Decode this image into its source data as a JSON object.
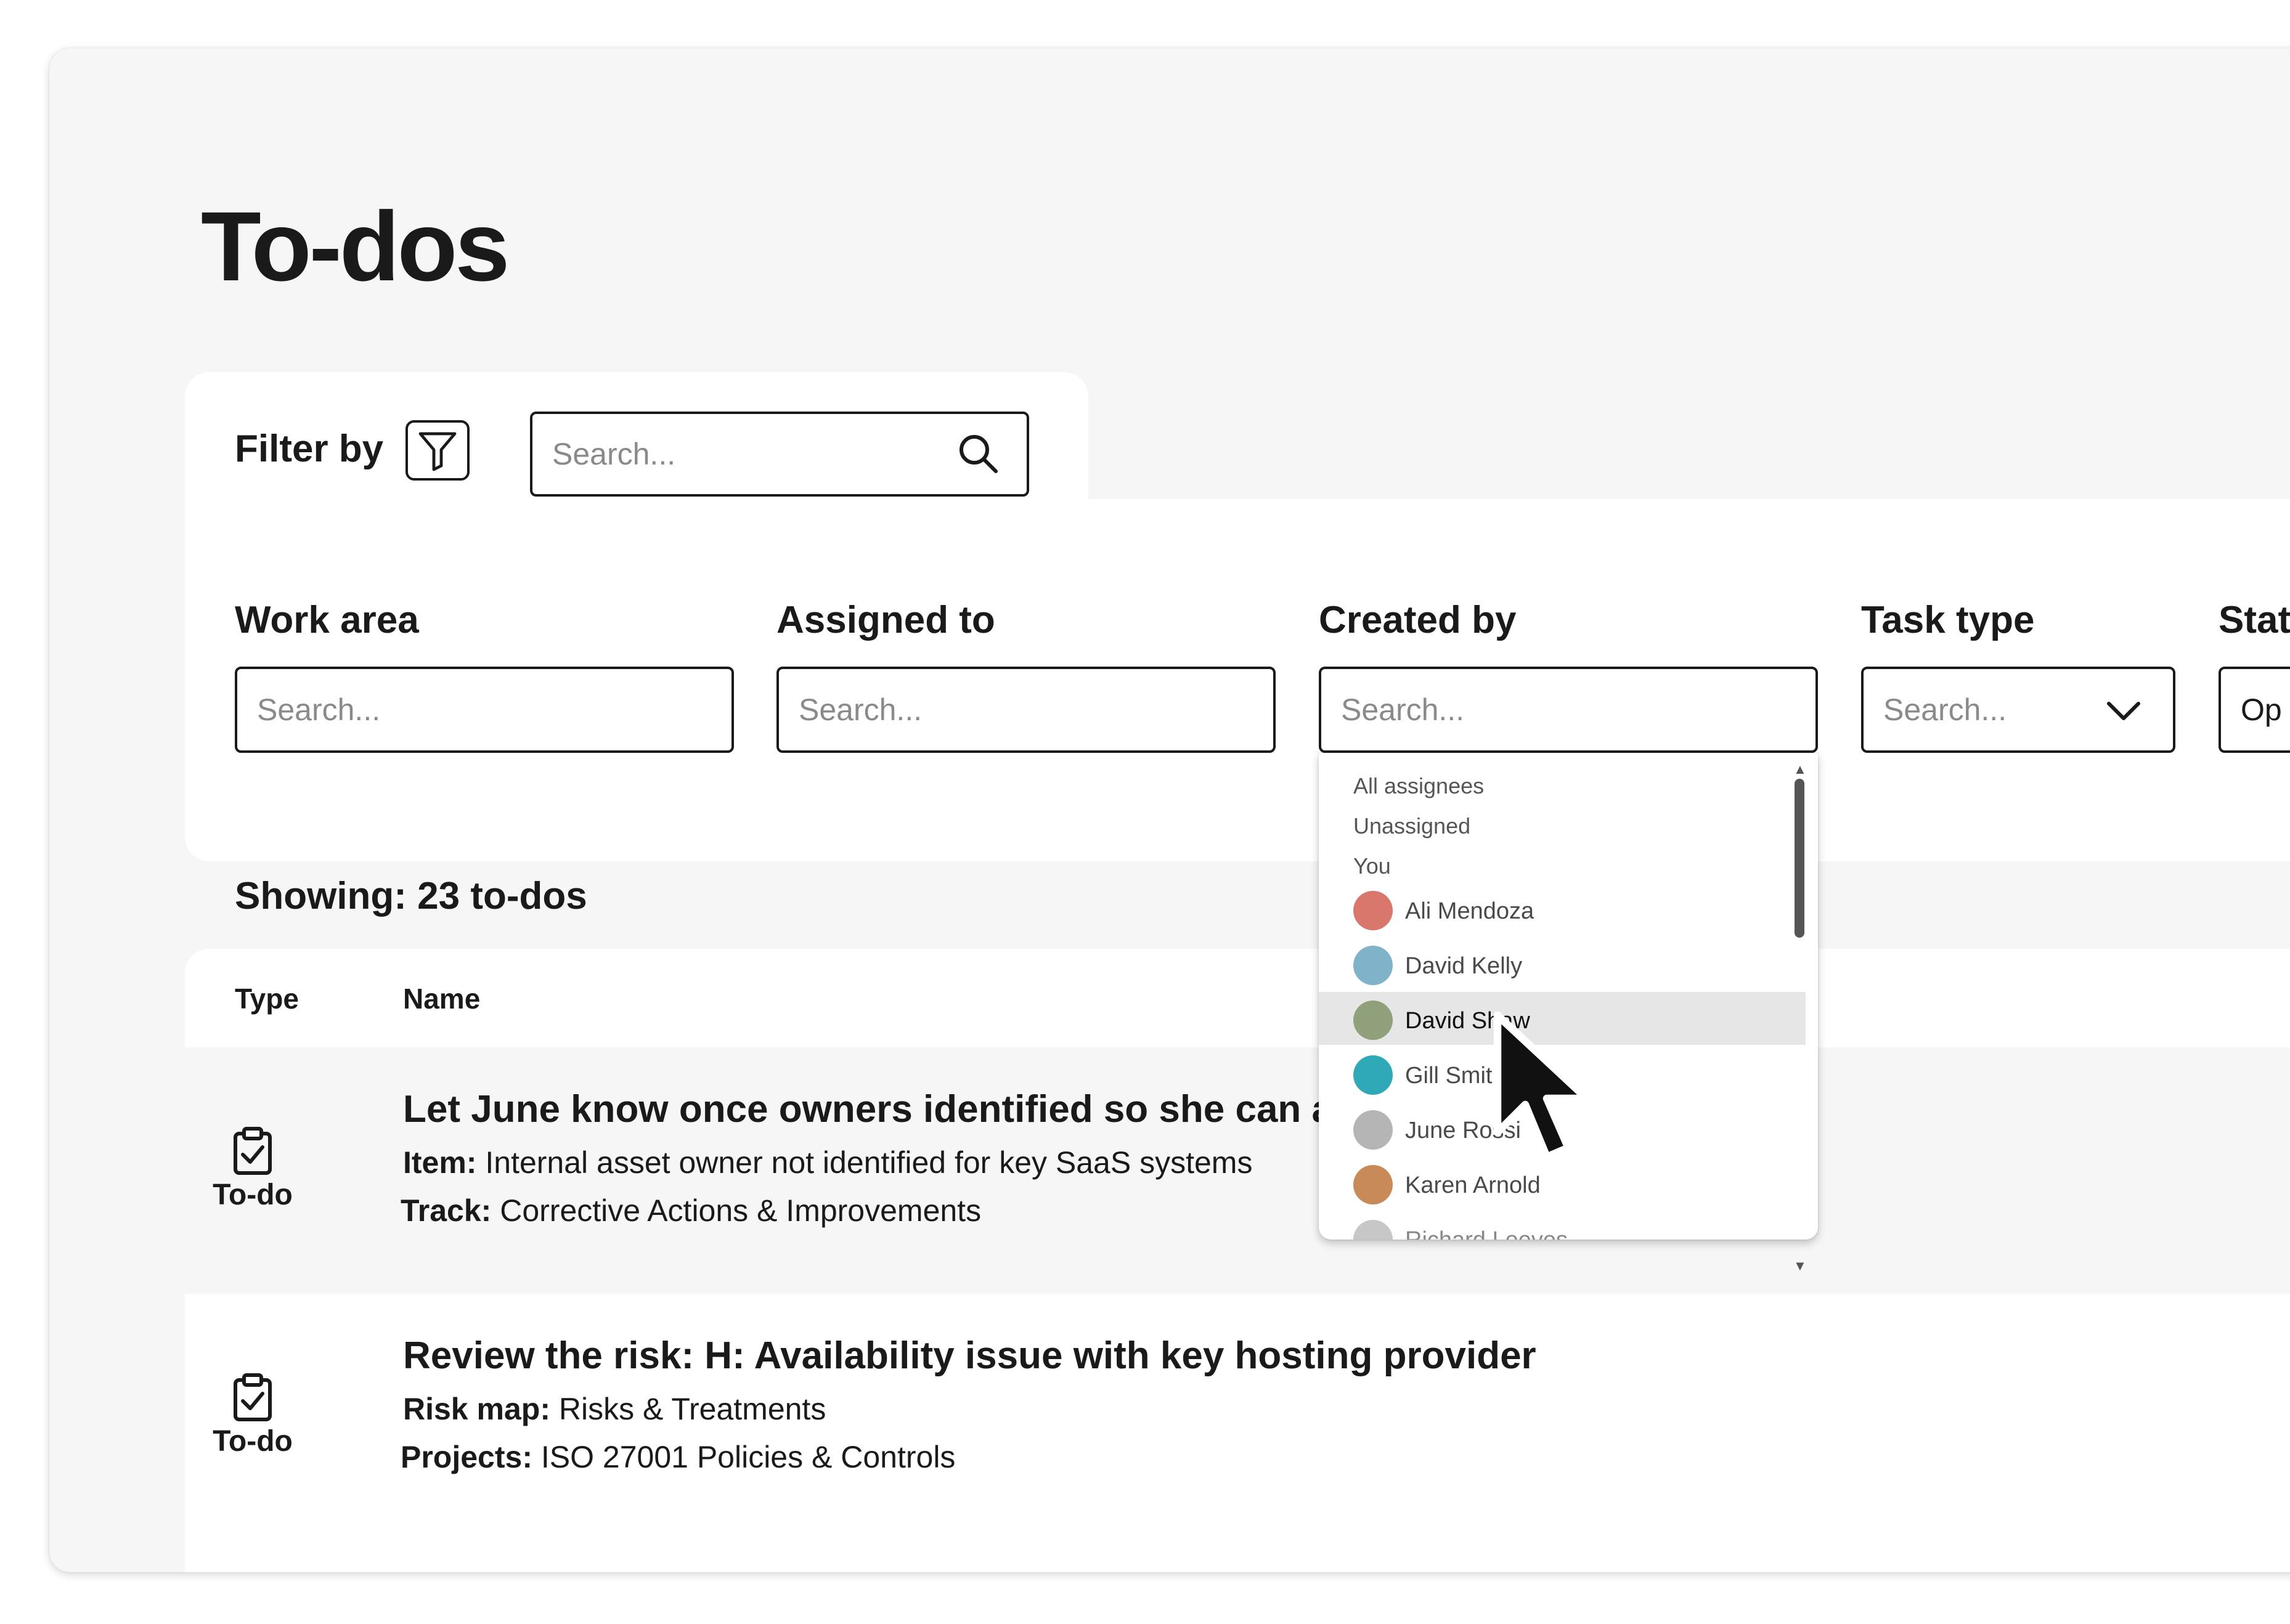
{
  "page": {
    "title": "To-dos"
  },
  "filters": {
    "filter_by_label": "Filter by",
    "search_placeholder": "Search...",
    "columns": [
      {
        "label": "Work area",
        "placeholder": "Search..."
      },
      {
        "label": "Assigned to",
        "placeholder": "Search..."
      },
      {
        "label": "Created by",
        "placeholder": "Search..."
      },
      {
        "label": "Task type",
        "placeholder": "Search..."
      },
      {
        "label": "Stat",
        "value": "Op"
      }
    ]
  },
  "summary": {
    "showing": "Showing: 23 to-dos"
  },
  "table": {
    "headers": [
      "Type",
      "Name"
    ],
    "rows": [
      {
        "type": "To-do",
        "title": "Let June know once owners identified so she can ar",
        "meta": [
          {
            "label": "Item:",
            "value": "Internal asset owner not identified for key SaaS systems"
          },
          {
            "label": "Track:",
            "value": "Corrective Actions & Improvements"
          }
        ]
      },
      {
        "type": "To-do",
        "title": "Review the risk: H: Availability issue with key hosting provider",
        "meta": [
          {
            "label": "Risk map:",
            "value": "Risks & Treatments"
          },
          {
            "label": "Projects:",
            "value": "ISO 27001 Policies & Controls"
          }
        ]
      }
    ]
  },
  "dropdown": {
    "options": [
      "All assignees",
      "Unassigned",
      "You"
    ],
    "people": [
      {
        "name": "Ali Mendoza",
        "color": "#d9776c"
      },
      {
        "name": "David Kelly",
        "color": "#7fb3c9"
      },
      {
        "name": "David Shaw",
        "color": "#8fa07a",
        "highlighted": true
      },
      {
        "name": "Gill Smith",
        "color": "#2fa9b8"
      },
      {
        "name": "June Rossi",
        "color": "#b5b5b5"
      },
      {
        "name": "Karen Arnold",
        "color": "#c98a5a"
      },
      {
        "name": "Richard Leeves",
        "color": "#c7c7c7"
      }
    ]
  },
  "colors": {
    "page_bg": "#f6f6f6",
    "panel_bg": "#ffffff",
    "highlight_row": "#e6e6e6",
    "text": "#1a1a1a"
  }
}
